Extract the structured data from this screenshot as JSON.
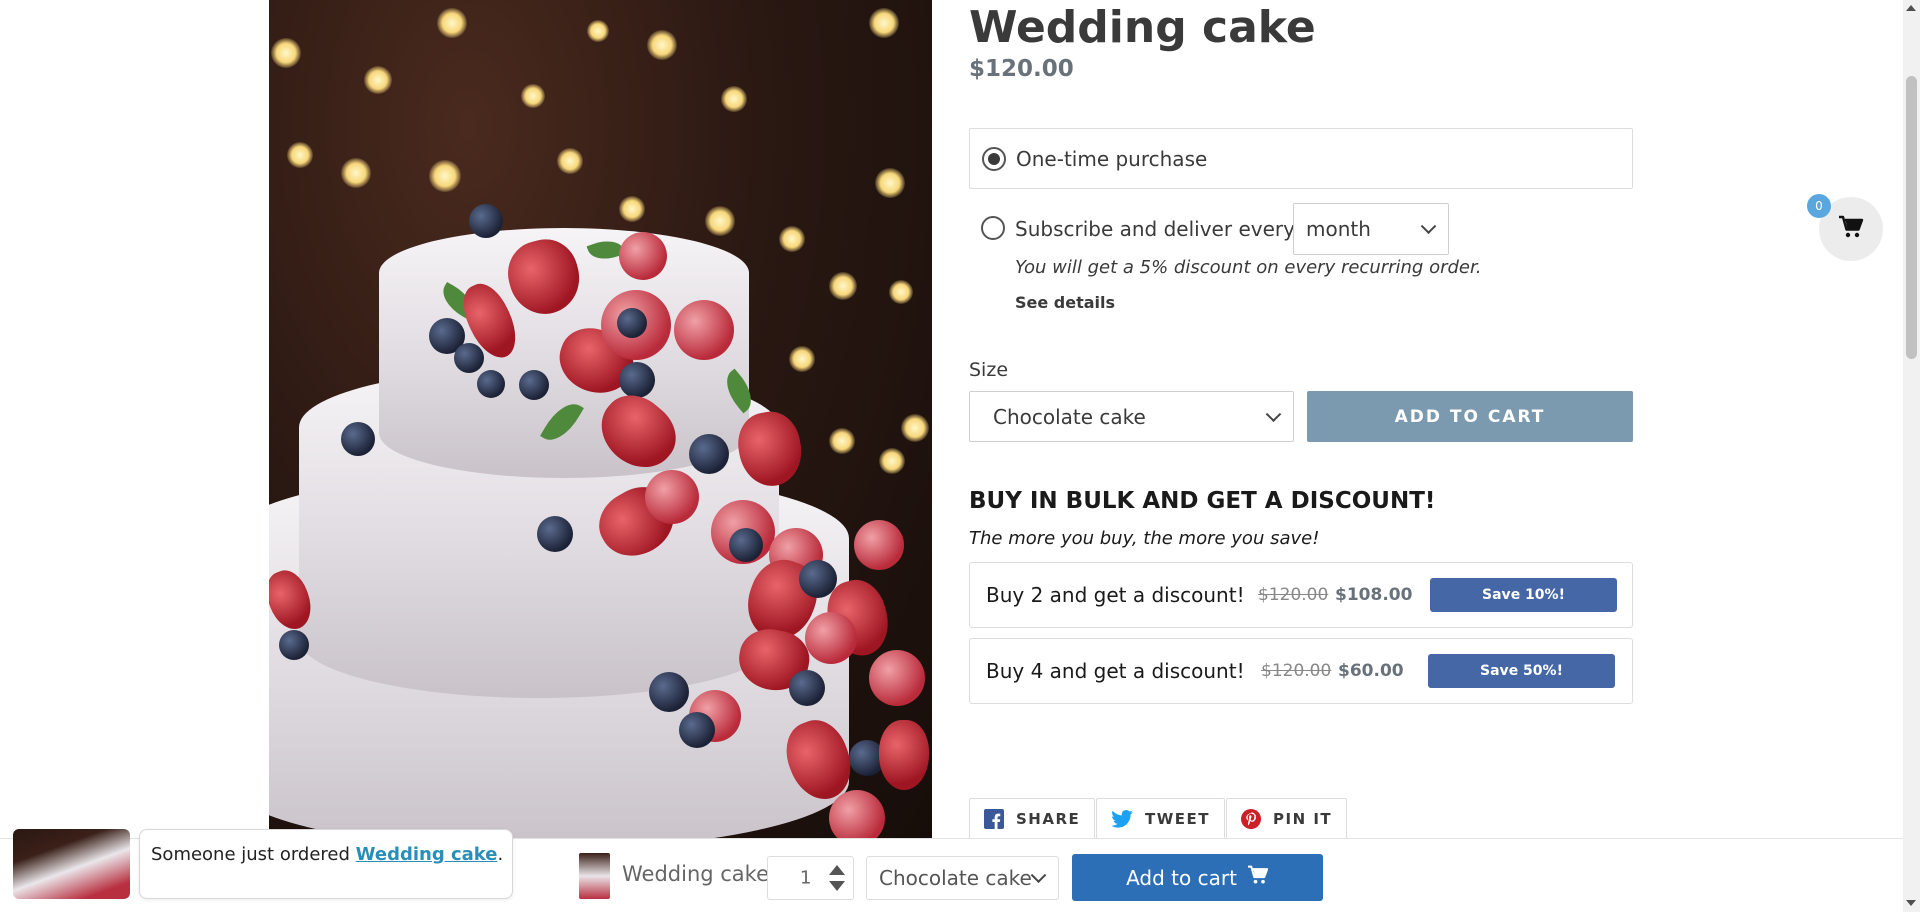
{
  "product": {
    "title": "Wedding cake",
    "price": "$120.00",
    "image_alt": "Wedding cake with berries"
  },
  "purchase_options": {
    "one_time_label": "One-time purchase",
    "subscribe_label": "Subscribe and deliver every",
    "frequency_selected": "month",
    "discount_note": "You will get a 5% discount on every recurring order.",
    "see_details": "See details",
    "selected": "one-time"
  },
  "variant": {
    "label": "Size",
    "selected": "Chocolate cake"
  },
  "add_to_cart_label": "ADD TO CART",
  "bulk": {
    "title": "BUY IN BULK AND GET A DISCOUNT!",
    "subtitle": "The more you buy, the more you save!",
    "tiers": [
      {
        "text": "Buy 2 and get a discount!",
        "old_price": "$120.00",
        "new_price": "$108.00",
        "save_label": "Save 10%!"
      },
      {
        "text": "Buy 4 and get a discount!",
        "old_price": "$120.00",
        "new_price": "$60.00",
        "save_label": "Save 50%!"
      }
    ]
  },
  "share": {
    "share_label": "SHARE",
    "tweet_label": "TWEET",
    "pin_label": "PIN IT"
  },
  "cart": {
    "count": "0"
  },
  "sticky_bar": {
    "product_name": "Wedding cake",
    "quantity": "1",
    "variant": "Chocolate cake",
    "add_label": "Add to cart"
  },
  "notification": {
    "prefix": "Someone just ordered ",
    "product_link": "Wedding cake",
    "suffix": "."
  },
  "colors": {
    "add_to_cart_disabled": "#7b9ab0",
    "save_button": "#4667a6",
    "sticky_add_button": "#2c6fb7",
    "cart_badge": "#5aa7e0",
    "notif_link": "#2a8fb8"
  }
}
